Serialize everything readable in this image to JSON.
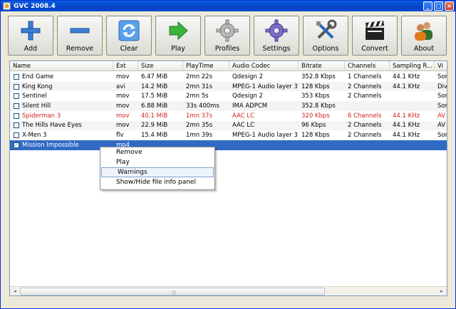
{
  "window": {
    "title": "GVC 2008.4",
    "minimize": "_",
    "maximize": "□",
    "close": "×"
  },
  "toolbar": [
    {
      "label": "Add",
      "icon": "plus-icon"
    },
    {
      "label": "Remove",
      "icon": "minus-icon"
    },
    {
      "label": "Clear",
      "icon": "refresh-icon"
    },
    {
      "label": "Play",
      "icon": "play-arrow-icon"
    },
    {
      "label": "Profiles",
      "icon": "gear-icon"
    },
    {
      "label": "Settings",
      "icon": "settings-gear-icon"
    },
    {
      "label": "Options",
      "icon": "tools-icon"
    },
    {
      "label": "Convert",
      "icon": "clapperboard-icon"
    },
    {
      "label": "About",
      "icon": "users-icon"
    }
  ],
  "columns": [
    "Name",
    "Ext",
    "Size",
    "PlayTime",
    "Audio Codec",
    "Bitrate",
    "Channels",
    "Sampling R...",
    "Vi"
  ],
  "rows": [
    {
      "name": "End Game",
      "ext": "mov",
      "size": "6.47 MiB",
      "playtime": "2mn 22s",
      "codec": "Qdesign 2",
      "bitrate": "352.8 Kbps",
      "channels": "1 Channels",
      "sampling": "44.1 KHz",
      "vi": "Sor"
    },
    {
      "name": "King Kong",
      "ext": "avi",
      "size": "14.2 MiB",
      "playtime": "2mn 31s",
      "codec": "MPEG-1 Audio layer 3",
      "bitrate": "128 Kbps",
      "channels": "2 Channels",
      "sampling": "44.1 KHz",
      "vi": "Div"
    },
    {
      "name": "Sentinel",
      "ext": "mov",
      "size": "17.5 MiB",
      "playtime": "2mn 5s",
      "codec": "Qdesign 2",
      "bitrate": "353 Kbps",
      "channels": "2 Channels",
      "sampling": "",
      "vi": "Sor"
    },
    {
      "name": "Silent Hill",
      "ext": "mov",
      "size": "6.88 MiB",
      "playtime": "33s 400ms",
      "codec": "IMA ADPCM",
      "bitrate": "352.8 Kbps",
      "channels": "",
      "sampling": "",
      "vi": "Sor"
    },
    {
      "name": "Spiderman 3",
      "ext": "mov",
      "size": "40.1 MiB",
      "playtime": "1mn 37s",
      "codec": "AAC LC",
      "bitrate": "320 Kbps",
      "channels": "6 Channels",
      "sampling": "44.1 KHz",
      "vi": "AV"
    },
    {
      "name": "The Hills Have Eyes",
      "ext": "mov",
      "size": "22.9 MiB",
      "playtime": "2mn 35s",
      "codec": "AAC LC",
      "bitrate": "96 Kbps",
      "channels": "2 Channels",
      "sampling": "44.1 KHz",
      "vi": "AV"
    },
    {
      "name": "X-Men 3",
      "ext": "flv",
      "size": "15.4 MiB",
      "playtime": "1mn 39s",
      "codec": "MPEG-1 Audio layer 3",
      "bitrate": "128 Kbps",
      "channels": "2 Channels",
      "sampling": "44.1 KHz",
      "vi": "Sor"
    },
    {
      "name": "Mission Impossible",
      "ext": "mp4",
      "size": "",
      "playtime": "",
      "codec": "",
      "bitrate": "",
      "channels": "",
      "sampling": "",
      "vi": ""
    }
  ],
  "context_menu": [
    "Remove",
    "Play",
    "Warnings",
    "Show/Hide file info panel"
  ],
  "scrollbar": {
    "left_arrow": "◂",
    "right_arrow": "▸",
    "grip": "|||"
  }
}
